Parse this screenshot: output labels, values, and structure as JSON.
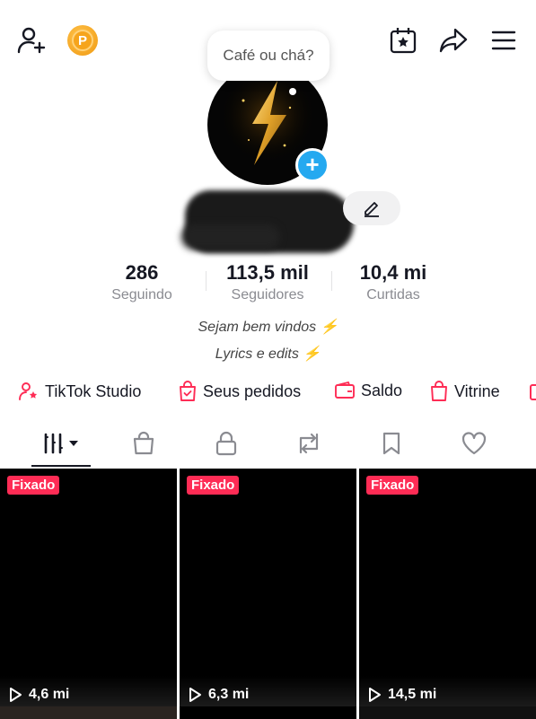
{
  "top_bar": {
    "add_friend_icon": "person-plus-icon",
    "coin_icon": "coin-p-icon",
    "coin_letter": "P",
    "calendar_icon": "calendar-star-icon",
    "share_icon": "share-arrow-icon",
    "menu_icon": "hamburger-menu-icon"
  },
  "profile": {
    "note_bubble": "Café ou chá?",
    "add_icon": "+"
  },
  "stats": [
    {
      "value": "286",
      "label": "Seguindo"
    },
    {
      "value": "113,5 mil",
      "label": "Seguidores"
    },
    {
      "value": "10,4 mi",
      "label": "Curtidas"
    }
  ],
  "bio": {
    "line1": "Sejam bem vindos ⚡",
    "line2": "Lyrics e edits ⚡"
  },
  "quick_links": [
    {
      "label": "TikTok Studio",
      "icon": "person-star-icon"
    },
    {
      "label": "Seus pedidos",
      "icon": "check-bag-icon"
    },
    {
      "label": "Saldo",
      "icon": "wallet-icon"
    },
    {
      "label": "Vitrine",
      "icon": "shopping-bag-icon"
    }
  ],
  "tabs": [
    "grid-filter-icon",
    "shop-bag-icon",
    "lock-icon",
    "repost-icon",
    "bookmark-icon",
    "heart-icon"
  ],
  "videos": [
    {
      "pinned_label": "Fixado",
      "views": "4,6 mi"
    },
    {
      "pinned_label": "Fixado",
      "views": "6,3 mi"
    },
    {
      "pinned_label": "Fixado",
      "views": "14,5 mi"
    }
  ],
  "colors": {
    "accent": "#fe2c55",
    "badge_blue": "#25a9f0"
  }
}
